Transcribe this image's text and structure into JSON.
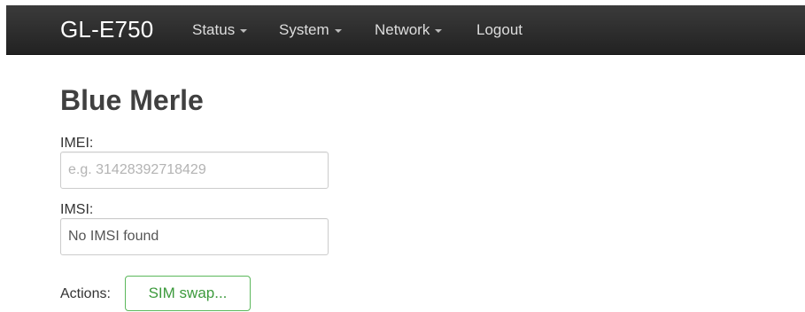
{
  "navbar": {
    "brand": "GL-E750",
    "items": [
      {
        "label": "Status",
        "has_dropdown": true
      },
      {
        "label": "System",
        "has_dropdown": true
      },
      {
        "label": "Network",
        "has_dropdown": true
      },
      {
        "label": "Logout",
        "has_dropdown": false
      }
    ]
  },
  "main": {
    "title": "Blue Merle",
    "imei": {
      "label": "IMEI:",
      "value": "",
      "placeholder": "e.g. 31428392718429"
    },
    "imsi": {
      "label": "IMSI:",
      "value": "No IMSI found",
      "placeholder": ""
    },
    "actions": {
      "label": "Actions:",
      "sim_swap_label": "SIM swap..."
    }
  },
  "colors": {
    "navbar_bg": "#222222",
    "title_text": "#404040",
    "button_accent": "#5cb85c"
  },
  "icons": {
    "dropdown": "caret-down-icon"
  }
}
